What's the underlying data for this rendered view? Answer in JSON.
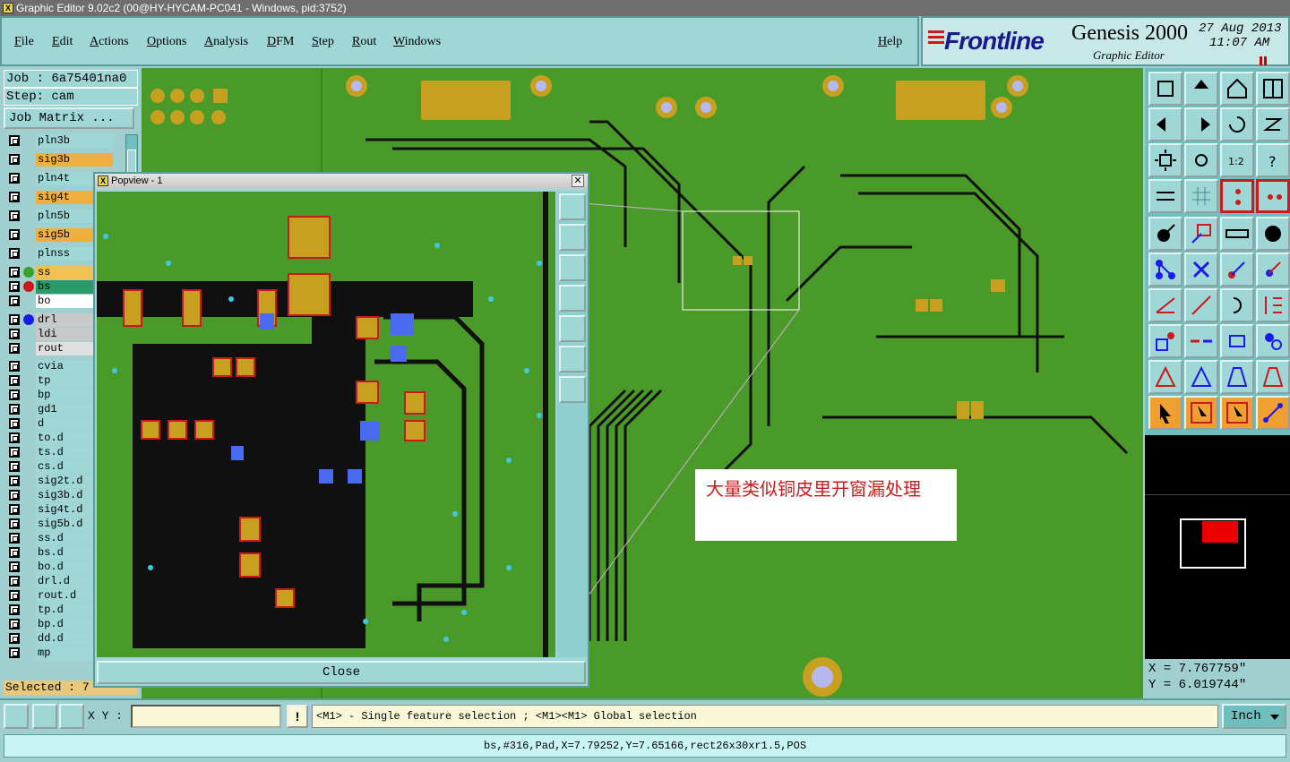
{
  "window": {
    "title": "Graphic Editor 9.02c2 (00@HY-HYCAM-PC041 - Windows, pid:3752)"
  },
  "menu": {
    "items": [
      "File",
      "Edit",
      "Actions",
      "Options",
      "Analysis",
      "DFM",
      "Step",
      "Rout",
      "Windows"
    ],
    "help": "Help"
  },
  "brand": {
    "logo": "Frontline",
    "product": "Genesis 2000",
    "subtitle": "Graphic Editor",
    "date": "27 Aug 2013",
    "time": "11:07 AM"
  },
  "job": {
    "job_label": "Job : 6a75401na0",
    "step_label": "Step: cam",
    "matrix_button": "Job Matrix ..."
  },
  "layers": [
    {
      "name": "pln3b",
      "color": "#9fd6d6",
      "dot": ""
    },
    {
      "name": "sig3b",
      "color": "#f0b040",
      "dot": ""
    },
    {
      "name": "pln4t",
      "color": "#9fd6d6",
      "dot": ""
    },
    {
      "name": "sig4t",
      "color": "#f0b040",
      "dot": ""
    },
    {
      "name": "pln5b",
      "color": "#9fd6d6",
      "dot": ""
    },
    {
      "name": "sig5b",
      "color": "#f0b040",
      "dot": ""
    },
    {
      "name": "plnss",
      "color": "#9fd6d6",
      "dot": ""
    },
    {
      "name": "ss",
      "color": "#f0c050",
      "dot": "#3aa030"
    },
    {
      "name": "bs",
      "color": "#2a9a6a",
      "dot": "#cc1a1a"
    },
    {
      "name": "bo",
      "color": "#ffffff",
      "dot": ""
    },
    {
      "name": "drl",
      "color": "#c8c8c8",
      "dot": "#1a1aee"
    },
    {
      "name": "ldi",
      "color": "#c8c8c8",
      "dot": ""
    },
    {
      "name": "rout",
      "color": "#e0e0e0",
      "dot": ""
    },
    {
      "name": "cvia",
      "color": "#9fd6d6",
      "dot": ""
    },
    {
      "name": "tp",
      "color": "#9fd6d6",
      "dot": ""
    },
    {
      "name": "bp",
      "color": "#9fd6d6",
      "dot": ""
    },
    {
      "name": "gd1",
      "color": "#9fd6d6",
      "dot": ""
    },
    {
      "name": "d",
      "color": "#9fd6d6",
      "dot": ""
    },
    {
      "name": "to.d",
      "color": "#9fd6d6",
      "dot": ""
    },
    {
      "name": "ts.d",
      "color": "#9fd6d6",
      "dot": ""
    },
    {
      "name": "cs.d",
      "color": "#9fd6d6",
      "dot": ""
    },
    {
      "name": "sig2t.d",
      "color": "#9fd6d6",
      "dot": ""
    },
    {
      "name": "sig3b.d",
      "color": "#9fd6d6",
      "dot": ""
    },
    {
      "name": "sig4t.d",
      "color": "#9fd6d6",
      "dot": ""
    },
    {
      "name": "sig5b.d",
      "color": "#9fd6d6",
      "dot": ""
    },
    {
      "name": "ss.d",
      "color": "#9fd6d6",
      "dot": ""
    },
    {
      "name": "bs.d",
      "color": "#9fd6d6",
      "dot": ""
    },
    {
      "name": "bo.d",
      "color": "#9fd6d6",
      "dot": ""
    },
    {
      "name": "drl.d",
      "color": "#9fd6d6",
      "dot": ""
    },
    {
      "name": "rout.d",
      "color": "#9fd6d6",
      "dot": ""
    },
    {
      "name": "tp.d",
      "color": "#9fd6d6",
      "dot": ""
    },
    {
      "name": "bp.d",
      "color": "#9fd6d6",
      "dot": ""
    },
    {
      "name": "dd.d",
      "color": "#9fd6d6",
      "dot": ""
    },
    {
      "name": "mp",
      "color": "#9fd6d6",
      "dot": ""
    }
  ],
  "selected": "Selected : 7",
  "popview": {
    "title": "Popview - 1",
    "close_label": "Close"
  },
  "annotation": "大量类似铜皮里开窗漏处理",
  "coords": {
    "x": "X = 7.767759\"",
    "y": "Y = 6.019744\""
  },
  "command": {
    "xy_label": "X Y :",
    "xy_value": "",
    "message": "<M1> - Single feature selection ; <M1><M1> Global selection",
    "unit": "Inch"
  },
  "status": "bs,#316,Pad,X=7.79252,Y=7.65166,rect26x30xr1.5,POS",
  "colors": {
    "board": "#4a9a2a",
    "pad": "#c8a020",
    "trace": "#101010",
    "drill": "#b8b8f0",
    "panel": "#9fd6d6"
  }
}
